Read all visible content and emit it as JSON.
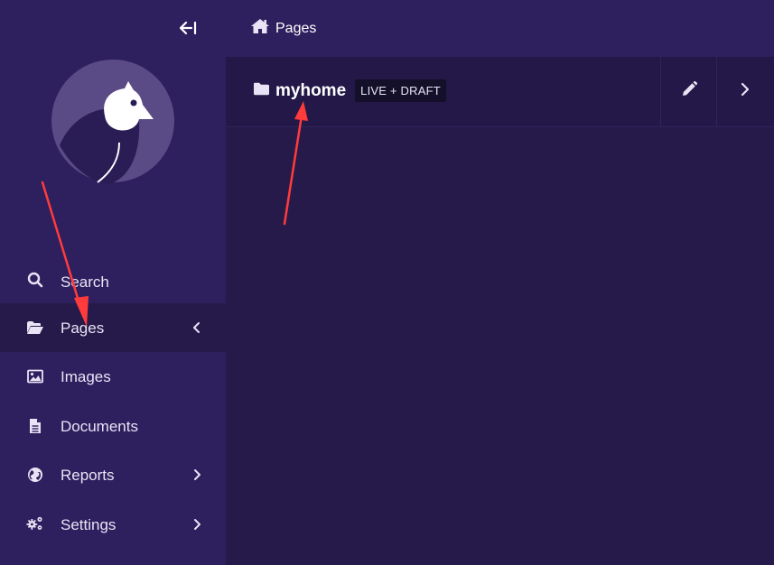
{
  "sidebar": {
    "collapse_icon": "collapse-left-icon",
    "logo_icon": "bird-logo-icon",
    "items": [
      {
        "label": "Search",
        "icon": "search-icon",
        "has_chevron": false
      },
      {
        "label": "Pages",
        "icon": "folder-open-icon",
        "has_chevron": true,
        "active": true
      },
      {
        "label": "Images",
        "icon": "image-icon",
        "has_chevron": false
      },
      {
        "label": "Documents",
        "icon": "document-icon",
        "has_chevron": false
      },
      {
        "label": "Reports",
        "icon": "globe-icon",
        "has_chevron": true
      },
      {
        "label": "Settings",
        "icon": "cogs-icon",
        "has_chevron": true
      }
    ]
  },
  "header": {
    "breadcrumb_icon": "home-icon",
    "breadcrumb_label": "Pages"
  },
  "listing": {
    "title_icon": "folder-icon",
    "title": "myhome",
    "status": "LIVE + DRAFT",
    "edit_icon": "pencil-icon",
    "next_icon": "chevron-right-icon"
  },
  "colors": {
    "sidebar_bg": "#2e1f5e",
    "content_bg": "#261a4b",
    "badge_bg": "#141029",
    "annotation_red": "#ff3b3b"
  }
}
